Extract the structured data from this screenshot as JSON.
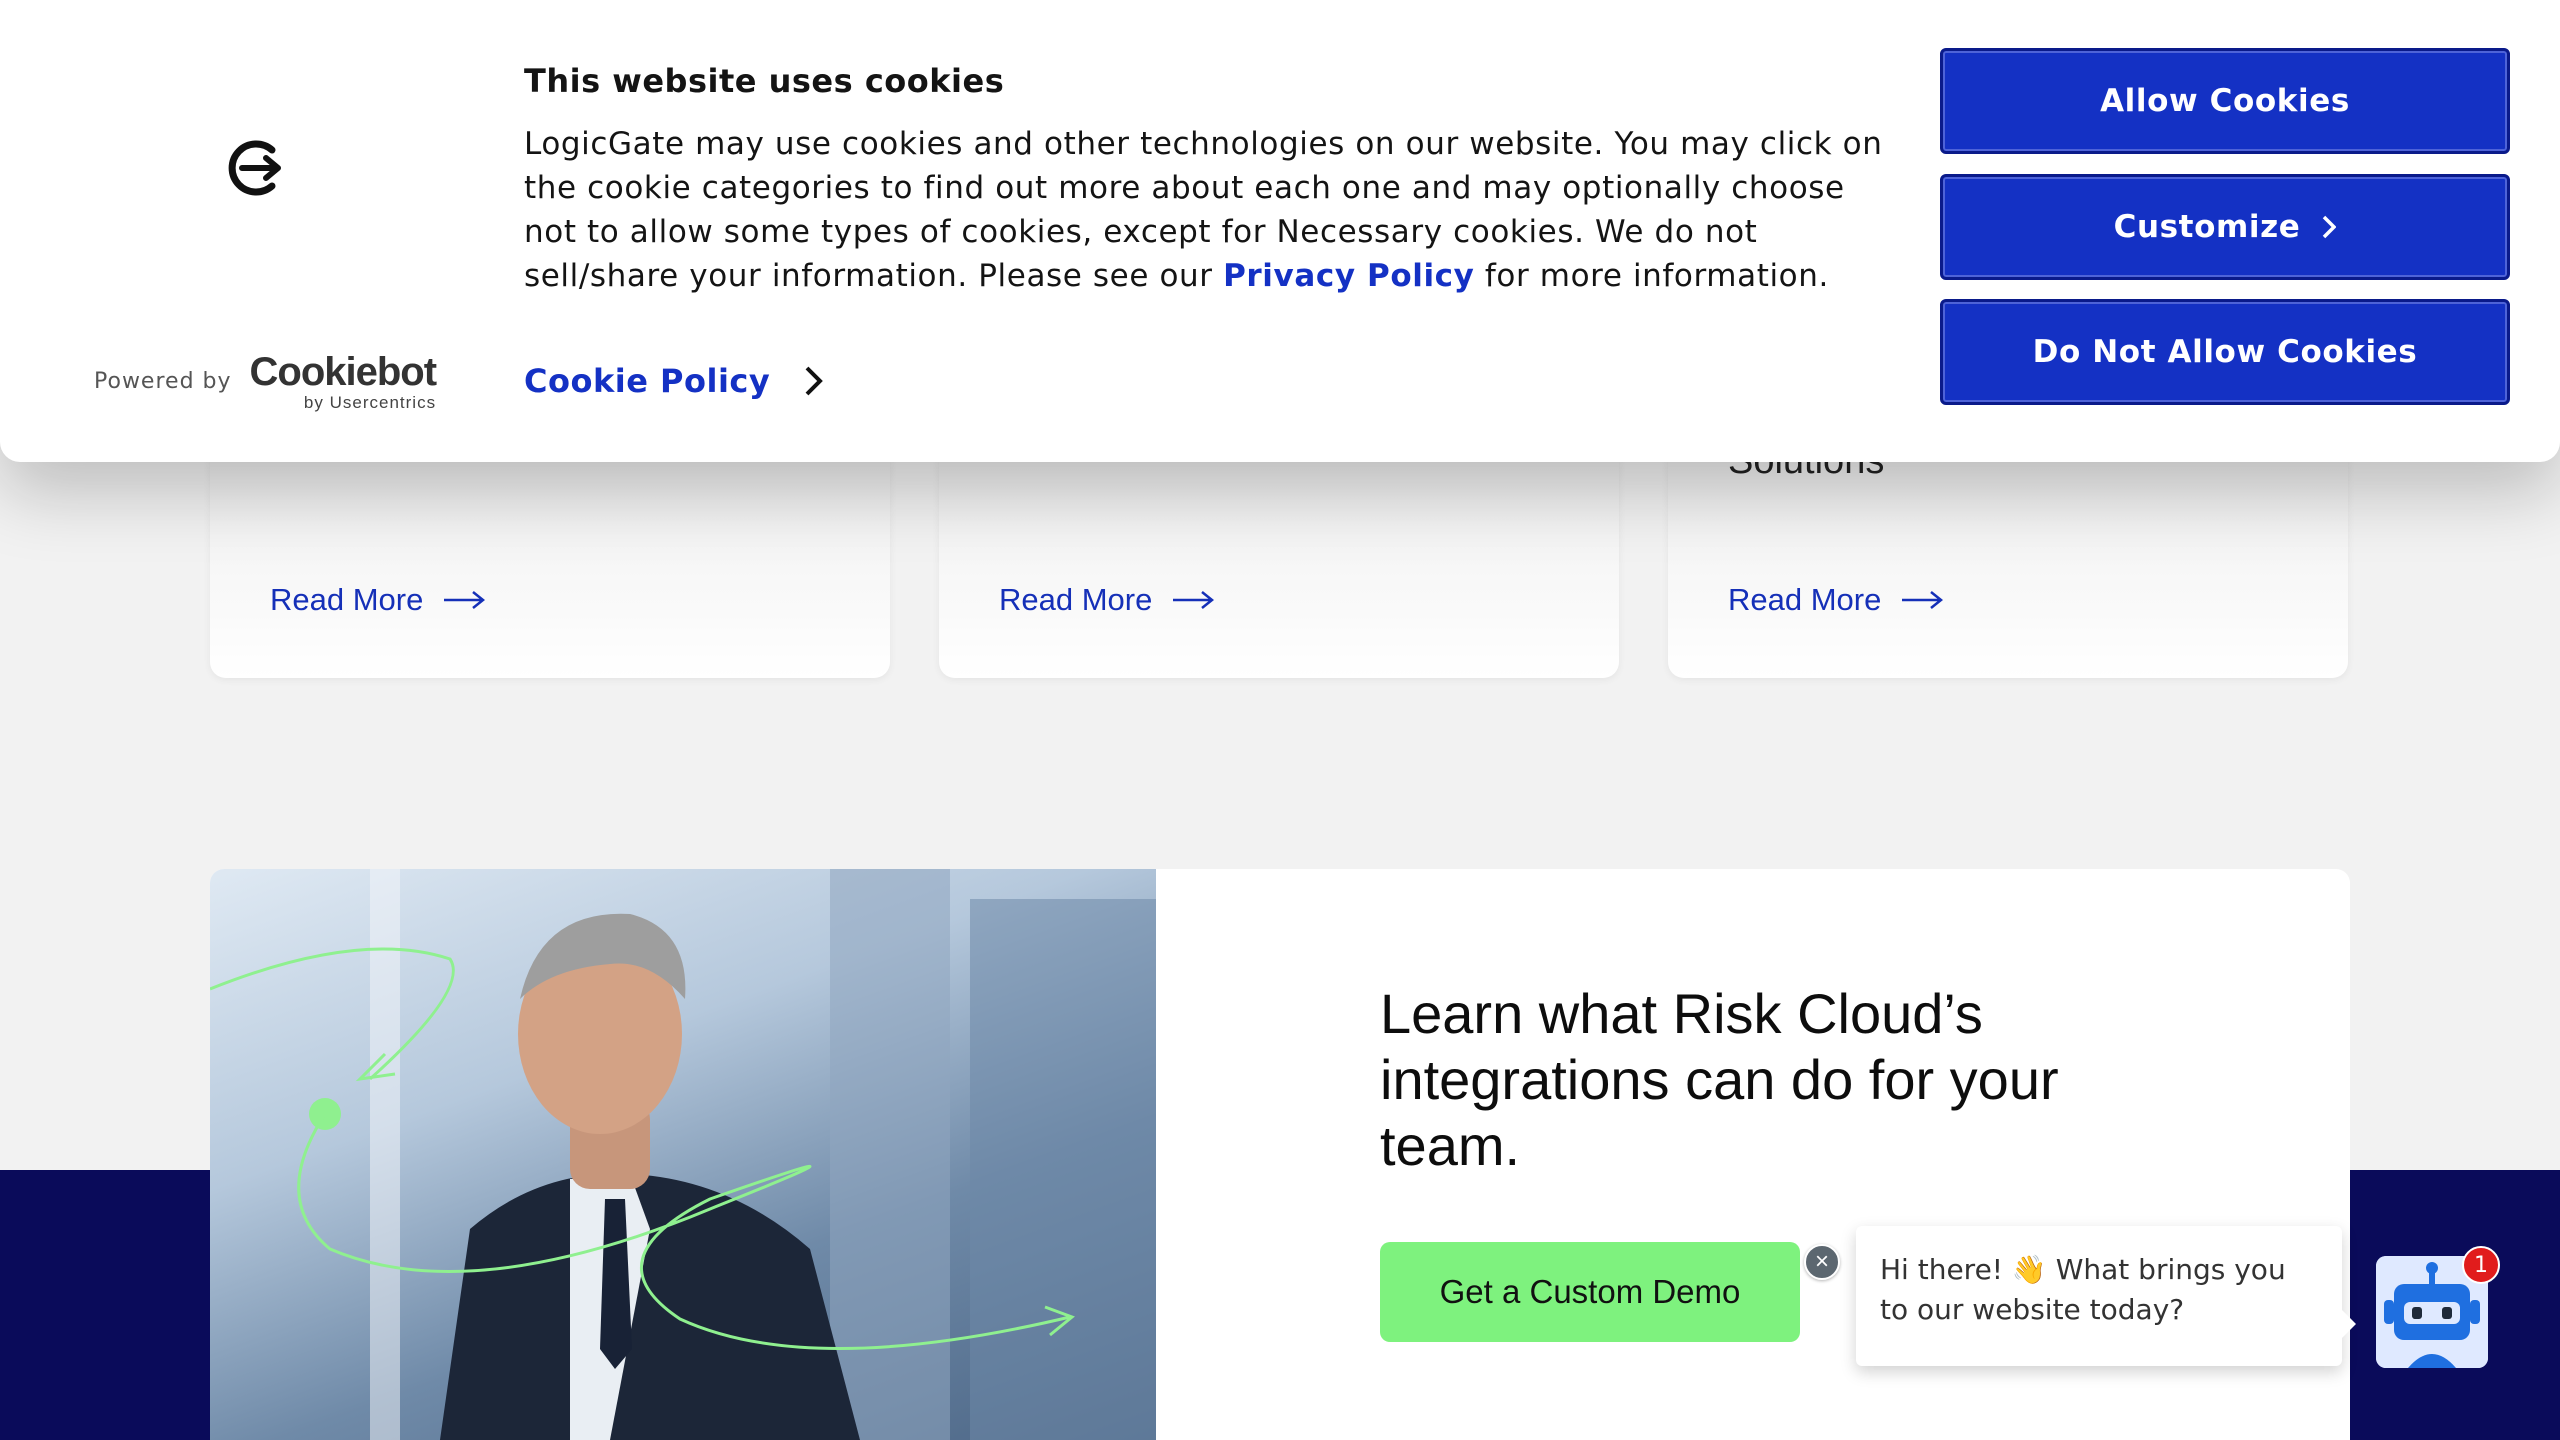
{
  "cookie_banner": {
    "title": "This website uses cookies",
    "text_before_link": "LogicGate may use cookies and other technologies on our website. You may click on the cookie categories to find out more about each one and may optionally choose not to allow some types of cookies, except for Necessary cookies.  We do not sell/share your information. Please see our ",
    "privacy_link": "Privacy Policy",
    "text_after_link": " for more information.",
    "cookie_policy_link": "Cookie Policy",
    "powered_by": "Powered by",
    "cookiebot_brand": "Cookiebot",
    "cookiebot_sub": "by Usercentrics",
    "buttons": {
      "allow": "Allow Cookies",
      "customize": "Customize",
      "deny": "Do Not Allow Cookies"
    },
    "button_color": "#1431c4"
  },
  "cards": [
    {
      "title_fragment": "",
      "read_more": "Read More"
    },
    {
      "title_fragment": "",
      "read_more": "Read More"
    },
    {
      "title_fragment": "Solutions",
      "read_more": "Read More"
    }
  ],
  "cta": {
    "heading": "Learn what Risk Cloud’s integrations can do for your team.",
    "button": "Get a Custom Demo",
    "button_color": "#7ef27e"
  },
  "chat": {
    "message": "Hi there! 👋 What brings you to our website today?",
    "badge_count": "1",
    "close_symbol": "×"
  },
  "colors": {
    "navy": "#0a0b5a",
    "link_blue": "#1530b8",
    "page_bg": "#f2f2f2"
  }
}
